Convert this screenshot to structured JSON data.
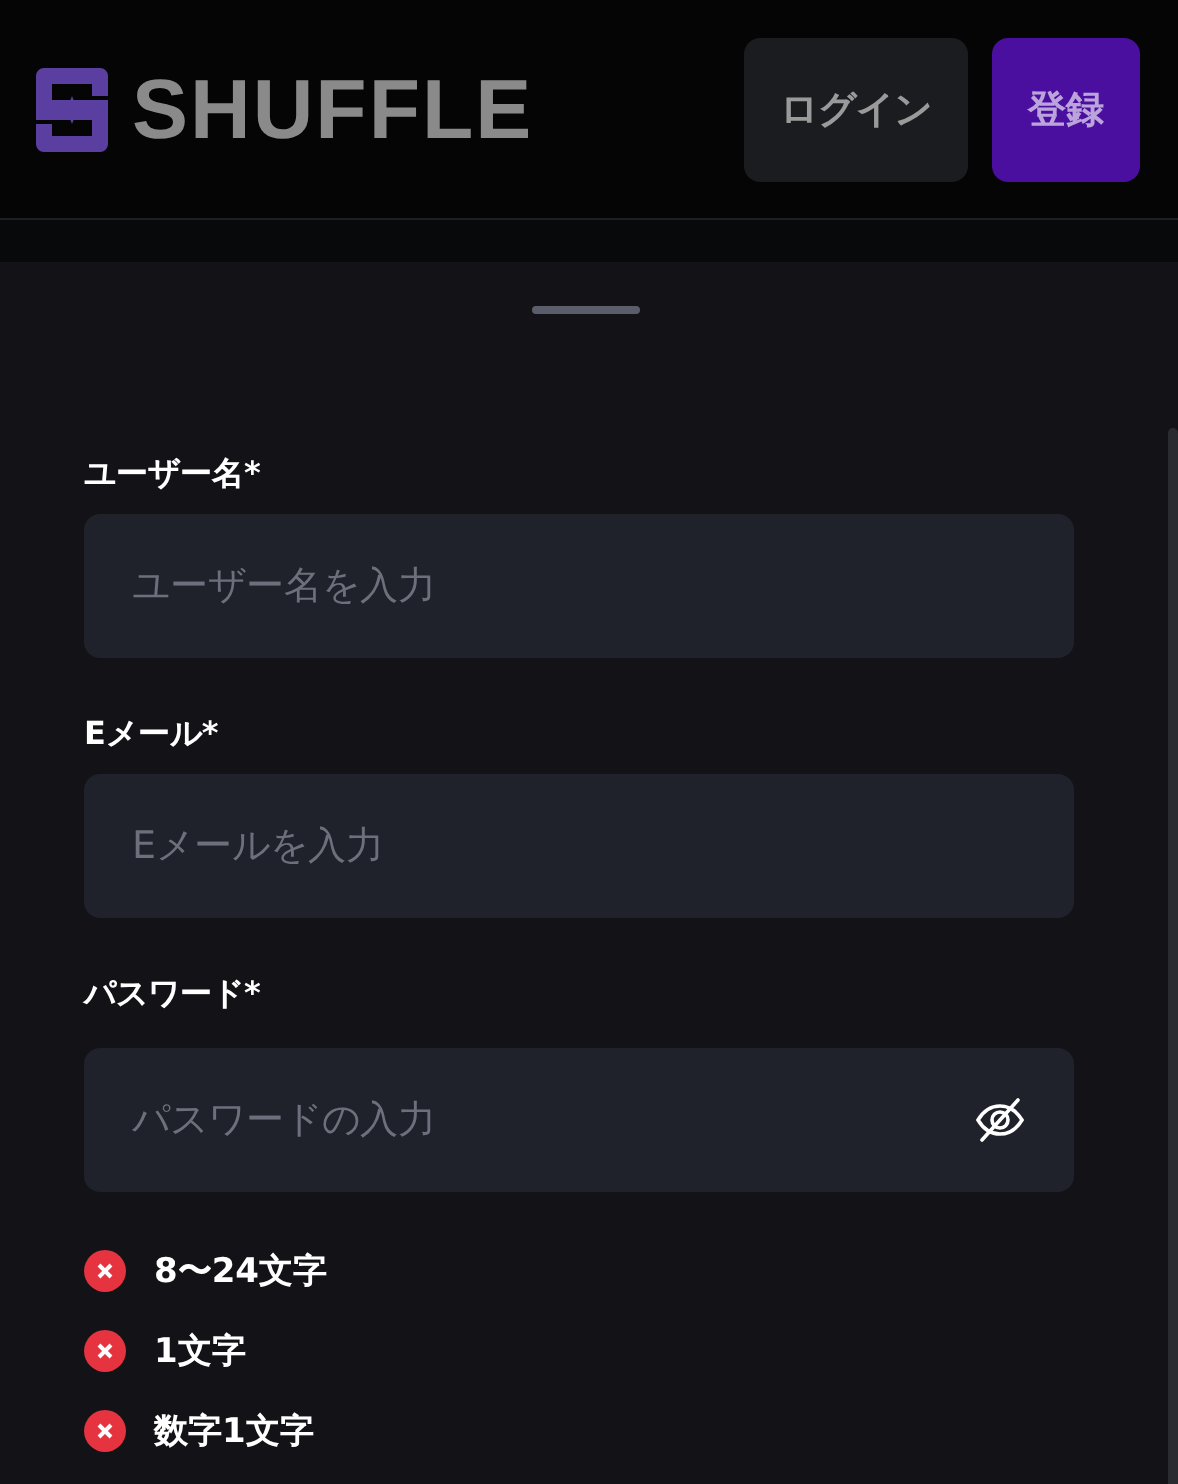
{
  "header": {
    "logo": "SHUFFLE",
    "buttons": [
      {
        "label": "ログイン",
        "kind": "secondary"
      },
      {
        "label": "登録",
        "kind": "primary"
      }
    ]
  },
  "form": {
    "fields": [
      {
        "label": "ユーザー名*",
        "placeholder": "ユーザー名を入力",
        "kind": "text"
      },
      {
        "label": "Eメール*",
        "placeholder": "Eメールを入力",
        "kind": "text"
      },
      {
        "label": "パスワード*",
        "placeholder": "パスワードの入力",
        "kind": "password"
      }
    ],
    "requirements": [
      {
        "text": "8〜24文字",
        "met": false
      },
      {
        "text": "1文字",
        "met": false
      },
      {
        "text": "数字1文字",
        "met": false
      }
    ]
  }
}
